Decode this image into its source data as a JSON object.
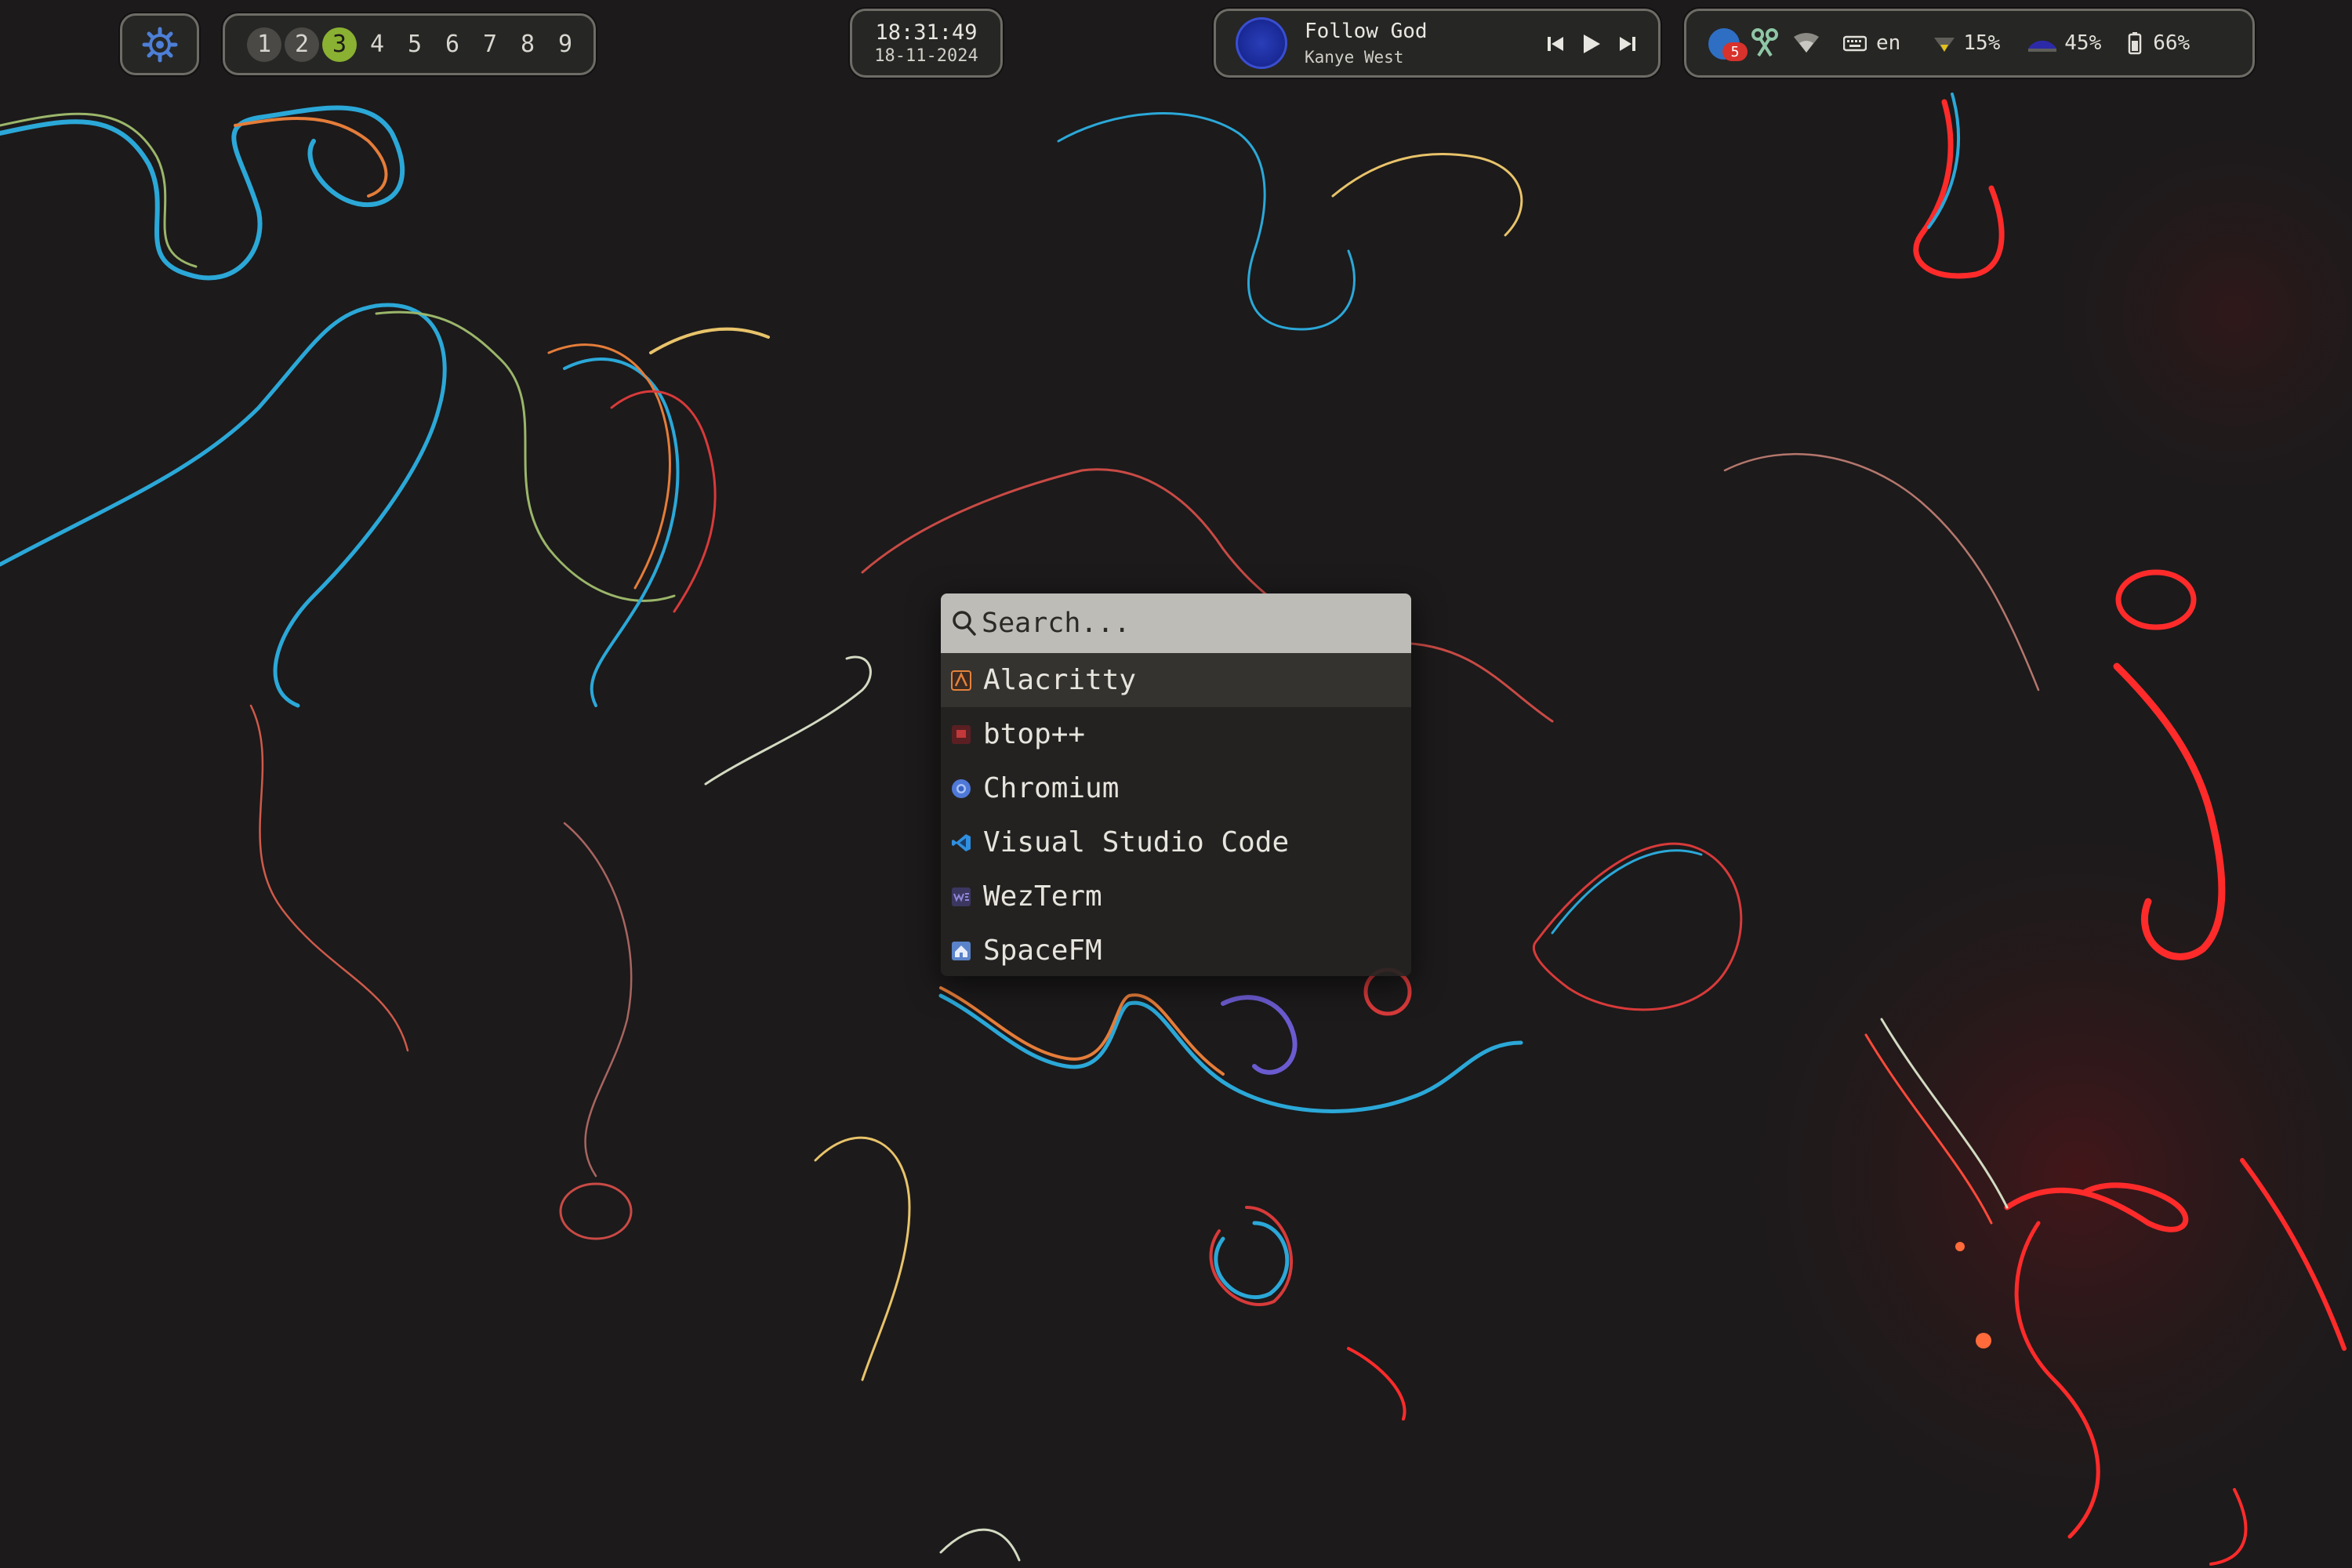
{
  "topbar": {
    "launcher_icon": "gear-icon",
    "workspaces": [
      {
        "label": "1",
        "state": "occupied"
      },
      {
        "label": "2",
        "state": "occupied"
      },
      {
        "label": "3",
        "state": "active"
      },
      {
        "label": "4",
        "state": "empty"
      },
      {
        "label": "5",
        "state": "empty"
      },
      {
        "label": "6",
        "state": "empty"
      },
      {
        "label": "7",
        "state": "empty"
      },
      {
        "label": "8",
        "state": "empty"
      },
      {
        "label": "9",
        "state": "empty"
      }
    ],
    "clock": {
      "time": "18:31:49",
      "date": "18-11-2024"
    },
    "media": {
      "title": "Follow God",
      "artist": "Kanye West",
      "controls": [
        "previous-icon",
        "play-icon",
        "next-icon"
      ]
    },
    "tray": {
      "notification_count": "5",
      "keyboard_layout": "en",
      "volume": "15%",
      "brightness": "45%",
      "battery": "66%",
      "icons": [
        "notification-icon",
        "screenshot-icon",
        "wifi-icon",
        "keyboard-icon",
        "volume-icon",
        "brightness-icon",
        "battery-icon"
      ]
    }
  },
  "launcher_menu": {
    "search_placeholder": "Search...",
    "search_value": "",
    "results": [
      {
        "label": "Alacritty",
        "icon": "alacritty-icon",
        "selected": true
      },
      {
        "label": "btop++",
        "icon": "btop-icon",
        "selected": false
      },
      {
        "label": "Chromium",
        "icon": "chromium-icon",
        "selected": false
      },
      {
        "label": "Visual Studio Code",
        "icon": "vscode-icon",
        "selected": false
      },
      {
        "label": "WezTerm",
        "icon": "wezterm-icon",
        "selected": false
      },
      {
        "label": "SpaceFM",
        "icon": "spacefm-icon",
        "selected": false
      }
    ]
  },
  "colors": {
    "accent_workspace": "#8ab132",
    "bar_background": "#262624",
    "bar_border": "#6e6c66",
    "menu_background": "#252421",
    "search_background": "#bdbcb7",
    "wallpaper": "#1c1a1b"
  }
}
